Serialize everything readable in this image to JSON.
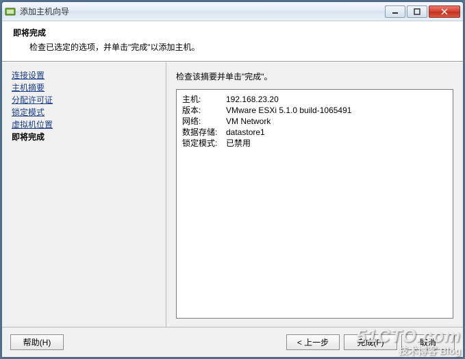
{
  "window": {
    "title": "添加主机向导"
  },
  "header": {
    "title": "即将完成",
    "subtitle": "检查已选定的选项，并单击\"完成\"以添加主机。"
  },
  "sidebar": {
    "items": [
      {
        "label": "连接设置"
      },
      {
        "label": "主机摘要"
      },
      {
        "label": "分配许可证"
      },
      {
        "label": "锁定模式"
      },
      {
        "label": "虚拟机位置"
      }
    ],
    "current": "即将完成"
  },
  "main": {
    "instruction": "检查该摘要并单击\"完成\"。",
    "summary": [
      {
        "label": "主机:",
        "value": "192.168.23.20"
      },
      {
        "label": "版本:",
        "value": "VMware ESXi 5.1.0 build-1065491"
      },
      {
        "label": "网络:",
        "value": "VM Network"
      },
      {
        "label": "数据存储:",
        "value": "datastore1"
      },
      {
        "label": "锁定模式:",
        "value": "已禁用"
      }
    ]
  },
  "footer": {
    "help": "帮助(H)",
    "back": "< 上一步",
    "finish": "完成(F)",
    "cancel": "取消"
  },
  "watermark": {
    "line1": "51CTO.com",
    "line2": "技术博客 Blog"
  }
}
